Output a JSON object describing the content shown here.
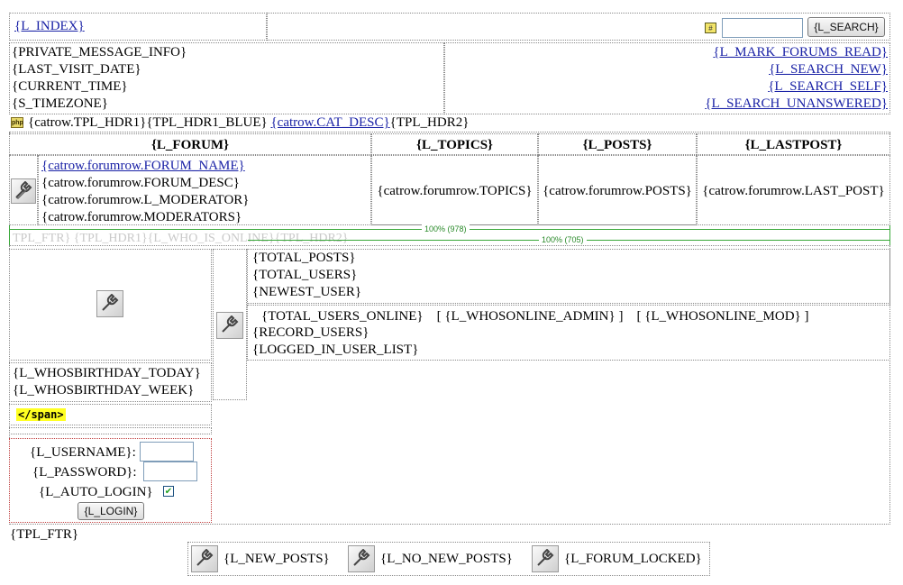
{
  "top": {
    "index_link": "{L_INDEX}",
    "search_button": "{L_SEARCH}",
    "search_value": ""
  },
  "info": {
    "lines": [
      "{PRIVATE_MESSAGE_INFO}",
      "{LAST_VISIT_DATE}",
      "{CURRENT_TIME}",
      "{S_TIMEZONE}"
    ],
    "links": [
      "{L_MARK_FORUMS_READ}",
      "{L_SEARCH_NEW}",
      "{L_SEARCH_SELF}",
      "{L_SEARCH_UNANSWERED}"
    ]
  },
  "cat_header": {
    "hdr1": "{catrow.TPL_HDR1}",
    "hdr1_blue": "{TPL_HDR1_BLUE}",
    "cat_desc": "{catrow.CAT_DESC}",
    "hdr2": "{TPL_HDR2}"
  },
  "forum_table": {
    "headers": [
      "{L_FORUM}",
      "{L_TOPICS}",
      "{L_POSTS}",
      "{L_LASTPOST}"
    ],
    "forum_name": "{catrow.forumrow.FORUM_NAME}",
    "forum_lines": [
      "{catrow.forumrow.FORUM_DESC}",
      "{catrow.forumrow.L_MODERATOR}",
      "{catrow.forumrow.MODERATORS}"
    ],
    "topics": "{catrow.forumrow.TOPICS}",
    "posts": "{catrow.forumrow.POSTS}",
    "lastpost": "{catrow.forumrow.LAST_POST}"
  },
  "guides": [
    "100% (978)",
    "100% (705)"
  ],
  "faded_row": "TPL_FTR} {TPL_HDR1}{L_WHO_IS_ONLINE}{TPL_HDR2}",
  "stats": {
    "totals": [
      "{TOTAL_POSTS}",
      "{TOTAL_USERS}",
      "{NEWEST_USER}"
    ],
    "online_line": "{TOTAL_USERS_ONLINE}    [ {L_WHOSONLINE_ADMIN} ]    [ {L_WHOSONLINE_MOD} ]",
    "more": [
      "{RECORD_USERS}",
      "{LOGGED_IN_USER_LIST}"
    ]
  },
  "birthday": [
    "{L_WHOSBIRTHDAY_TODAY}",
    "{L_WHOSBIRTHDAY_WEEK}"
  ],
  "span_tag": "</span>",
  "login": {
    "username_label": "{L_USERNAME}:",
    "password_label": "{L_PASSWORD}:",
    "auto_login_label": "{L_AUTO_LOGIN}",
    "auto_login_checked": true,
    "login_button": "{L_LOGIN}",
    "username_value": "",
    "password_value": ""
  },
  "footer": "{TPL_FTR}",
  "legend": [
    "{L_NEW_POSTS}",
    "{L_NO_NEW_POSTS}",
    "{L_FORUM_LOCKED}"
  ],
  "icons": {
    "tool": "tools-icon",
    "php": "php-script-icon",
    "search_small": "search-icon",
    "check": "checkmark-icon"
  },
  "colors": {
    "link": "#1a22a6",
    "guide": "#3aa83a",
    "highlight": "#ffff22"
  }
}
